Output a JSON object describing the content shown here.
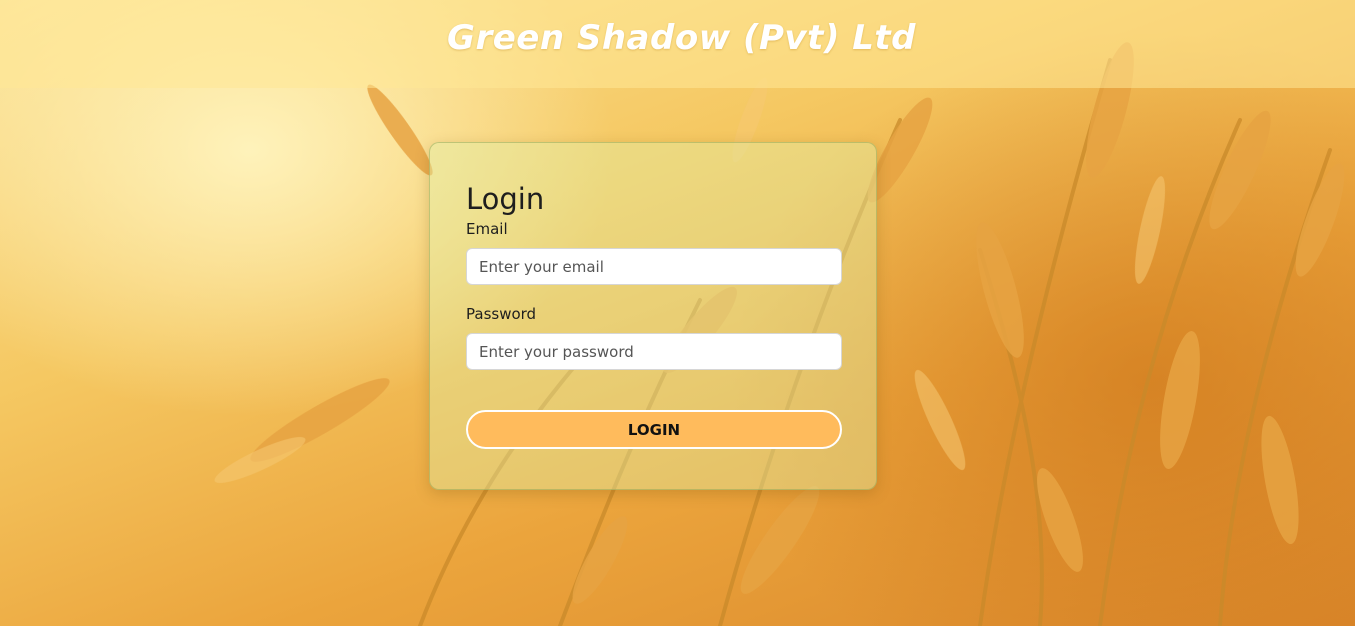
{
  "header": {
    "title": "Green Shadow (Pvt) Ltd"
  },
  "login": {
    "heading": "Login",
    "email_label": "Email",
    "email_placeholder": "Enter your email",
    "email_value": "",
    "password_label": "Password",
    "password_placeholder": "Enter your password",
    "password_value": "",
    "button_label": "LOGIN"
  },
  "colors": {
    "button_fill": "#ffbb5c",
    "header_text": "#ffffff",
    "background_accent": "#f5c862"
  }
}
